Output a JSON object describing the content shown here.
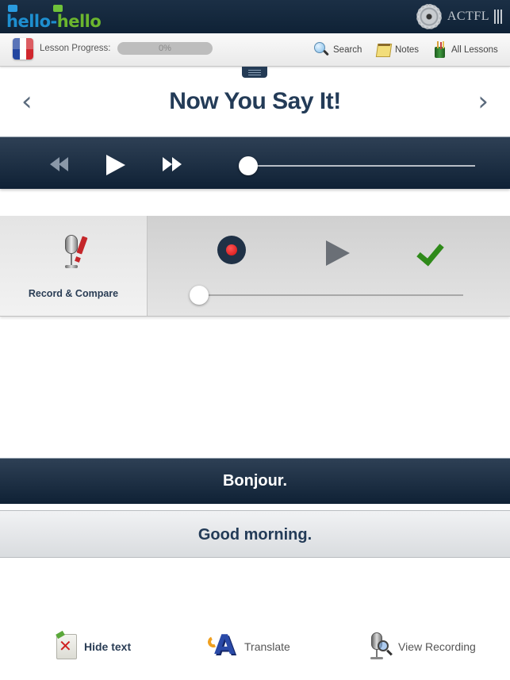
{
  "header": {
    "logo": {
      "part1": "hello",
      "dash": "-",
      "part2": "hello"
    },
    "partner": {
      "text": "ACTFL"
    }
  },
  "toolbar": {
    "progress_label": "Lesson Progress:",
    "progress_value": "0%",
    "progress_fraction": 0,
    "search_label": "Search",
    "notes_label": "Notes",
    "all_lessons_label": "All Lessons"
  },
  "colors": {
    "navy": "#1b2f45",
    "title": "#233b57",
    "flag_blue": "#2346a0",
    "flag_white": "#ffffff",
    "flag_red": "#d0272e",
    "record_red": "#d01010",
    "check_green": "#2f8a1a"
  },
  "title_row": {
    "prev_icon": "‹",
    "title": "Now You Say It!",
    "next_icon": "›"
  },
  "player": {
    "position_fraction": 0
  },
  "record_compare": {
    "label": "Record & Compare",
    "position_fraction": 0
  },
  "phrase": {
    "foreign": "Bonjour.",
    "native": "Good morning."
  },
  "actions": {
    "hide_text": "Hide text",
    "translate": "Translate",
    "view_recording": "View Recording"
  }
}
